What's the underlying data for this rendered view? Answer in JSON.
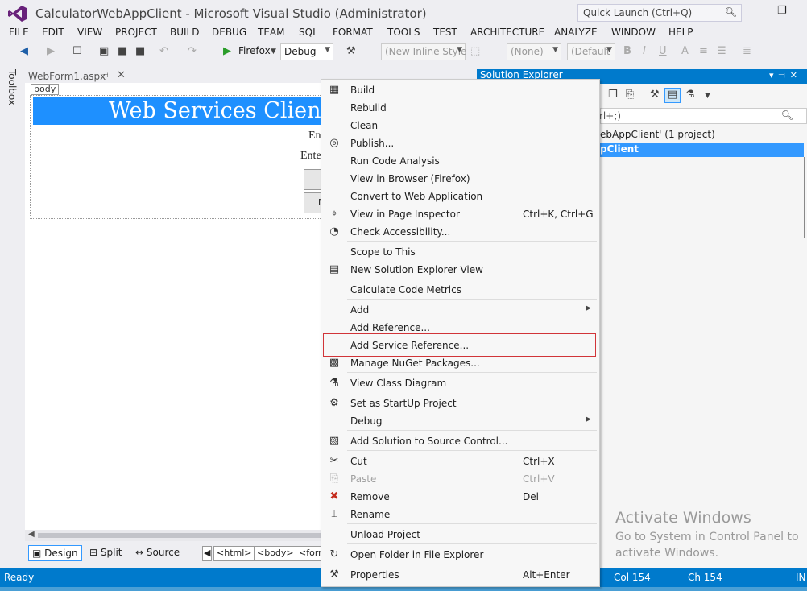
{
  "window": {
    "title": "CalculatorWebAppClient - Microsoft Visual Studio (Administrator)",
    "quick_launch_placeholder": "Quick Launch (Ctrl+Q)"
  },
  "menubar": [
    "FILE",
    "EDIT",
    "VIEW",
    "PROJECT",
    "BUILD",
    "DEBUG",
    "TEAM",
    "SQL",
    "FORMAT",
    "TOOLS",
    "TEST",
    "ARCHITECTURE",
    "ANALYZE",
    "WINDOW",
    "HELP"
  ],
  "toolbar": {
    "run_target": "Firefox",
    "configuration": "Debug",
    "style_combo": "(New Inline Style",
    "target_combo": "(None)",
    "font_combo": "(Default",
    "bold": "B",
    "italic": "I",
    "underline": "U",
    "font_color": "A"
  },
  "toolbox_label": "Toolbox",
  "document": {
    "tab_name": "WebForm1.aspx",
    "body_tag": "body",
    "banner_text": "Web Services Client fo",
    "label1": "En",
    "label2": "Ente",
    "button_stub": "N",
    "views": [
      "Design",
      "Split",
      "Source"
    ],
    "breadcrumbs": [
      "<html>",
      "<body>",
      "<form"
    ]
  },
  "solution_explorer": {
    "title": "Solution Explorer",
    "search_text": "rl+;)",
    "solution_row": "ebAppClient' (1 project)",
    "project_row": "pClient"
  },
  "context_menu": {
    "items": [
      {
        "label": "Build",
        "icon": "build-icon"
      },
      {
        "label": "Rebuild"
      },
      {
        "label": "Clean"
      },
      {
        "label": "Publish...",
        "icon": "publish-icon"
      },
      {
        "label": "Run Code Analysis"
      },
      {
        "label": "View in Browser (Firefox)"
      },
      {
        "label": "Convert to Web Application"
      },
      {
        "label": "View in Page Inspector",
        "shortcut": "Ctrl+K, Ctrl+G",
        "icon": "page-inspector-icon"
      },
      {
        "label": "Check Accessibility...",
        "icon": "accessibility-icon"
      },
      {
        "label": "Scope to This"
      },
      {
        "label": "New Solution Explorer View",
        "icon": "new-view-icon"
      },
      {
        "label": "Calculate Code Metrics"
      },
      {
        "label": "Add"
      },
      {
        "label": "Add Reference..."
      },
      {
        "label": "Add Service Reference..."
      },
      {
        "label": "Manage NuGet Packages...",
        "icon": "nuget-icon"
      },
      {
        "label": "View Class Diagram",
        "icon": "class-diagram-icon"
      },
      {
        "label": "Set as StartUp Project",
        "icon": "gear-icon"
      },
      {
        "label": "Debug"
      },
      {
        "label": "Add Solution to Source Control...",
        "icon": "source-control-icon"
      },
      {
        "label": "Cut",
        "shortcut": "Ctrl+X",
        "icon": "cut-icon"
      },
      {
        "label": "Paste",
        "shortcut": "Ctrl+V",
        "icon": "paste-icon",
        "disabled": true
      },
      {
        "label": "Remove",
        "shortcut": "Del",
        "icon": "remove-icon"
      },
      {
        "label": "Rename",
        "icon": "rename-icon"
      },
      {
        "label": "Unload Project"
      },
      {
        "label": "Open Folder in File Explorer",
        "icon": "open-folder-icon"
      },
      {
        "label": "Properties",
        "shortcut": "Alt+Enter",
        "icon": "wrench-icon"
      }
    ]
  },
  "watermark": {
    "line1": "Activate Windows",
    "line2": "Go to System in Control Panel to activate Windows."
  },
  "statusbar": {
    "status": "Ready",
    "col": "Col 154",
    "ch": "Ch 154",
    "mode": "IN"
  },
  "colors": {
    "accent": "#007acc",
    "banner": "#1e90ff",
    "highlight_border": "#d13438"
  }
}
